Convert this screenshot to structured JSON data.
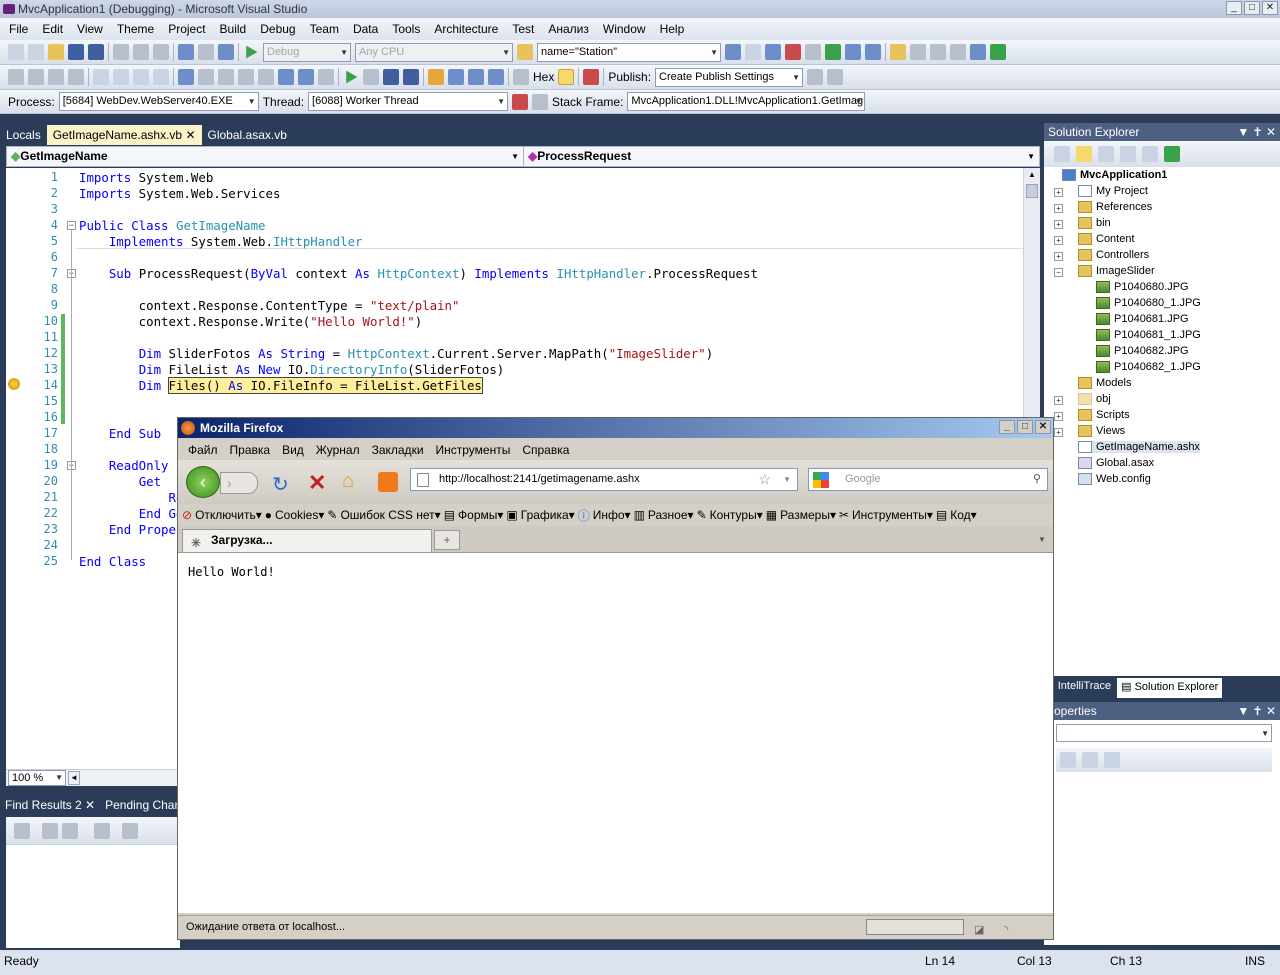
{
  "window": {
    "title": "MvcApplication1 (Debugging) - Microsoft Visual Studio"
  },
  "menu": [
    "File",
    "Edit",
    "View",
    "Theme",
    "Project",
    "Build",
    "Debug",
    "Team",
    "Data",
    "Tools",
    "Architecture",
    "Test",
    "Анализ",
    "Window",
    "Help"
  ],
  "toolbar1": {
    "config": "Debug",
    "platform": "Any CPU",
    "find": "name=\"Station\""
  },
  "toolbar2": {
    "hex": "Hex",
    "publish_label": "Publish:",
    "publish_value": "Create Publish Settings"
  },
  "debugbar": {
    "process_label": "Process:",
    "process_value": "[5684] WebDev.WebServer40.EXE",
    "thread_label": "Thread:",
    "thread_value": "[6088] Worker Thread",
    "stackframe_label": "Stack Frame:",
    "stackframe_value": "MvcApplication1.DLL!MvcApplication1.GetImag"
  },
  "doc_tabs": [
    "Locals",
    "GetImageName.ashx.vb",
    "Global.asax.vb"
  ],
  "nav": {
    "class": "GetImageName",
    "method": "ProcessRequest"
  },
  "editor": {
    "line_numbers": [
      "1",
      "2",
      "3",
      "4",
      "5",
      "6",
      "7",
      "8",
      "9",
      "10",
      "11",
      "12",
      "13",
      "14",
      "15",
      "16",
      "17",
      "18",
      "19",
      "20",
      "21",
      "22",
      "23",
      "24",
      "25"
    ],
    "line1": "Imports System.Web",
    "line2": "Imports System.Web.Services",
    "line4": "Public Class GetImageName",
    "line5": "    Implements System.Web.IHttpHandler",
    "line7": "    Sub ProcessRequest(ByVal context As HttpContext) Implements IHttpHandler.ProcessRequest",
    "line9": "        context.Response.ContentType = \"text/plain\"",
    "line10": "        context.Response.Write(\"Hello World!\")",
    "line12": "        Dim SliderFotos As String = HttpContext.Current.Server.MapPath(\"ImageSlider\")",
    "line13": "        Dim FileList As New IO.DirectoryInfo(SliderFotos)",
    "line14a": "        Dim ",
    "line14b": "Files() As IO.FileInfo = FileList.GetFiles",
    "line17": "    End Sub",
    "line19": "    ReadOnly P",
    "line20": "        Get",
    "line21": "            Re",
    "line22": "        End Ge",
    "line23": "    End Proper",
    "line25": "End Class"
  },
  "zoom": "100 %",
  "bottom_tabs": [
    "Find Results 2",
    "Pending Chang"
  ],
  "solution_explorer": {
    "title": "Solution Explorer",
    "root": "MvcApplication1",
    "items": [
      "My Project",
      "References",
      "bin",
      "Content",
      "Controllers",
      "ImageSlider",
      "P1040680.JPG",
      "P1040680_1.JPG",
      "P1040681.JPG",
      "P1040681_1.JPG",
      "P1040682.JPG",
      "P1040682_1.JPG",
      "Models",
      "obj",
      "Scripts",
      "Views",
      "GetImageName.ashx",
      "Global.asax",
      "Web.config"
    ],
    "tabs": [
      "IntelliTrace",
      "Solution Explorer"
    ]
  },
  "properties": {
    "title": "operties"
  },
  "status": {
    "ready": "Ready",
    "ln": "Ln 14",
    "col": "Col 13",
    "ch": "Ch 13",
    "ins": "INS"
  },
  "firefox": {
    "title": "Mozilla Firefox",
    "menu": [
      "Файл",
      "Правка",
      "Вид",
      "Журнал",
      "Закладки",
      "Инструменты",
      "Справка"
    ],
    "url": "http://localhost:2141/getimagename.ashx",
    "search_placeholder": "Google",
    "devbar": [
      "Отключить▾",
      "Cookies▾",
      "Ошибок CSS нет▾",
      "Формы▾",
      "Графика▾",
      "Инфо▾",
      "Разное▾",
      "Контуры▾",
      "Размеры▾",
      "Инструменты▾",
      "Код▾"
    ],
    "tab": "Загрузка...",
    "content": "Hello World!",
    "status": "Ожидание ответа от localhost..."
  }
}
